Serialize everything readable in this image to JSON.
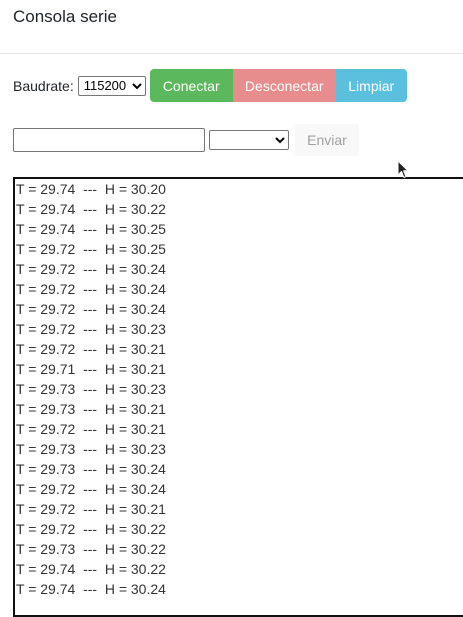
{
  "header": {
    "title": "Consola serie"
  },
  "controls": {
    "baud_label": "Baudrate:",
    "baud_selected": "115200",
    "connect_label": "Conectar",
    "disconnect_label": "Desconectar",
    "clear_label": "Limpiar"
  },
  "send": {
    "input_value": "",
    "line_ending_selected": "",
    "send_label": "Enviar"
  },
  "colors": {
    "connect": "#5cb85c",
    "disconnect": "#e88d8d",
    "clear": "#5bc0de"
  },
  "serial": {
    "lines": [
      "T = 29.74  ---  H = 30.20",
      "T = 29.74  ---  H = 30.22",
      "T = 29.74  ---  H = 30.25",
      "T = 29.72  ---  H = 30.25",
      "T = 29.72  ---  H = 30.24",
      "T = 29.72  ---  H = 30.24",
      "T = 29.72  ---  H = 30.24",
      "T = 29.72  ---  H = 30.23",
      "T = 29.72  ---  H = 30.21",
      "T = 29.71  ---  H = 30.21",
      "T = 29.73  ---  H = 30.23",
      "T = 29.73  ---  H = 30.21",
      "T = 29.72  ---  H = 30.21",
      "T = 29.73  ---  H = 30.23",
      "T = 29.73  ---  H = 30.24",
      "T = 29.72  ---  H = 30.24",
      "T = 29.72  ---  H = 30.21",
      "T = 29.72  ---  H = 30.22",
      "T = 29.73  ---  H = 30.22",
      "T = 29.74  ---  H = 30.22",
      "T = 29.74  ---  H = 30.24"
    ]
  }
}
